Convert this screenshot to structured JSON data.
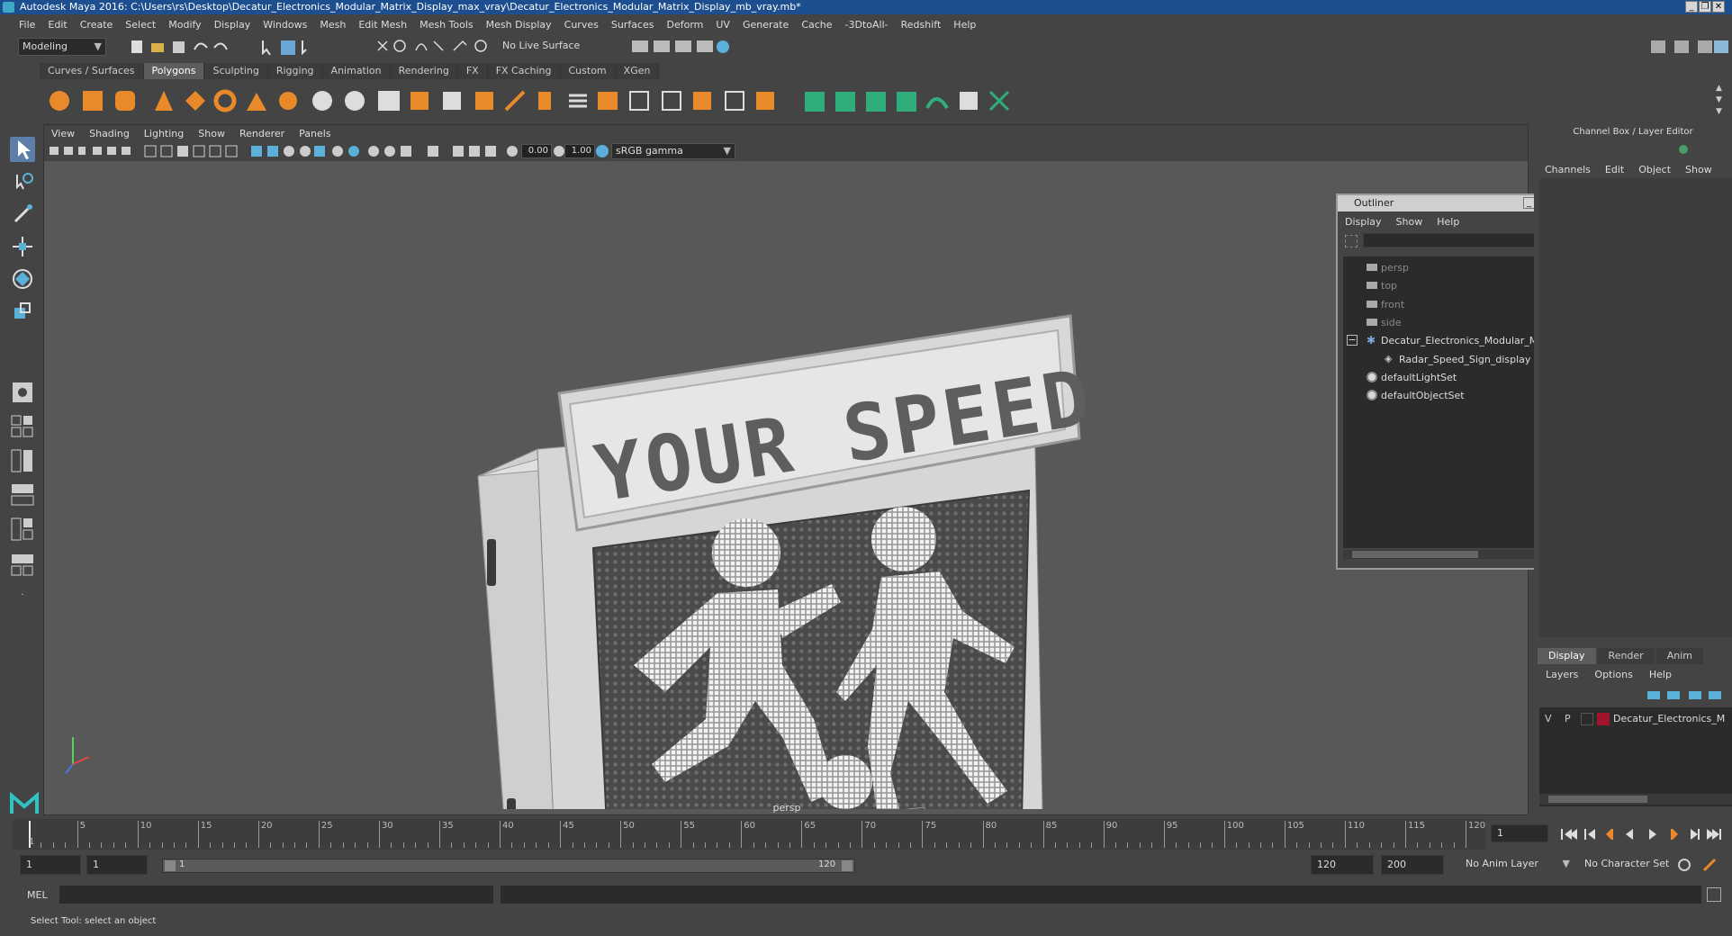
{
  "window": {
    "title": "Autodesk Maya 2016: C:\\Users\\rs\\Desktop\\Decatur_Electronics_Modular_Matrix_Display_max_vray\\Decatur_Electronics_Modular_Matrix_Display_mb_vray.mb*"
  },
  "menubar": [
    "File",
    "Edit",
    "Create",
    "Select",
    "Modify",
    "Display",
    "Windows",
    "Mesh",
    "Edit Mesh",
    "Mesh Tools",
    "Mesh Display",
    "Curves",
    "Surfaces",
    "Deform",
    "UV",
    "Generate",
    "Cache",
    "-3DtoAll-",
    "Redshift",
    "Help"
  ],
  "toolbar": {
    "mode": "Modeling",
    "live_surface": "No Live Surface"
  },
  "shelf_tabs": [
    "Curves / Surfaces",
    "Polygons",
    "Sculpting",
    "Rigging",
    "Animation",
    "Rendering",
    "FX",
    "FX Caching",
    "Custom",
    "XGen"
  ],
  "shelf_active": "Polygons",
  "viewport": {
    "menu": [
      "View",
      "Shading",
      "Lighting",
      "Show",
      "Renderer",
      "Panels"
    ],
    "exposure": "0.00",
    "gamma": "1.00",
    "color_space": "sRGB gamma",
    "camera_label": "persp",
    "sign_text": "YOUR SPEED"
  },
  "outliner": {
    "title": "Outliner",
    "menu": [
      "Display",
      "Show",
      "Help"
    ],
    "items": [
      {
        "label": "persp",
        "type": "camera"
      },
      {
        "label": "top",
        "type": "camera"
      },
      {
        "label": "front",
        "type": "camera"
      },
      {
        "label": "side",
        "type": "camera"
      },
      {
        "label": "Decatur_Electronics_Modular_Ma",
        "type": "group"
      },
      {
        "label": "Radar_Speed_Sign_display",
        "type": "mesh"
      },
      {
        "label": "defaultLightSet",
        "type": "set"
      },
      {
        "label": "defaultObjectSet",
        "type": "set"
      }
    ]
  },
  "channel_box": {
    "header": "Channel Box / Layer Editor",
    "menu": [
      "Channels",
      "Edit",
      "Object",
      "Show"
    ]
  },
  "layer_editor": {
    "tabs": [
      "Display",
      "Render",
      "Anim"
    ],
    "active_tab": "Display",
    "menu": [
      "Layers",
      "Options",
      "Help"
    ],
    "layer": {
      "v": "V",
      "p": "P",
      "name": "Decatur_Electronics_M",
      "color": "#a0142c"
    }
  },
  "timeline": {
    "ticks": [
      "5",
      "10",
      "15",
      "20",
      "25",
      "30",
      "35",
      "40",
      "45",
      "50",
      "55",
      "60",
      "65",
      "70",
      "75",
      "80",
      "85",
      "90",
      "95",
      "100",
      "105",
      "110",
      "115",
      "120"
    ],
    "first": "1",
    "current_frame": "1"
  },
  "range": {
    "start": "1",
    "playback_start": "1",
    "slider_start": "1",
    "slider_end": "120",
    "playback_end": "120",
    "end": "200",
    "anim_layer": "No Anim Layer",
    "character_set": "No Character Set"
  },
  "command_line": {
    "label": "MEL"
  },
  "help_line": "Select Tool: select an object"
}
